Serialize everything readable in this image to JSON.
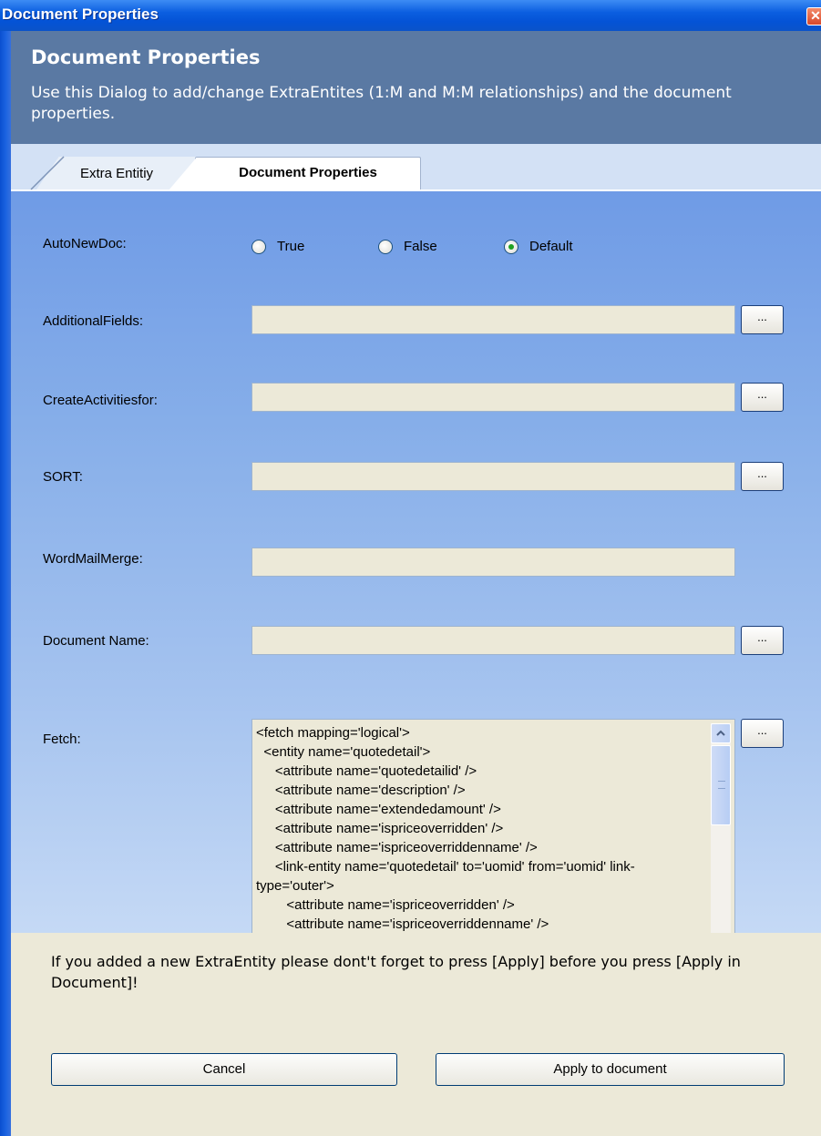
{
  "window": {
    "title": "Document Properties",
    "close_glyph": "✕"
  },
  "header": {
    "title": "Document Properties",
    "description": "Use this Dialog to add/change ExtraEntites (1:M and M:M relationships) and the document properties."
  },
  "tabs": [
    {
      "label": "Extra Entitiy",
      "active": false
    },
    {
      "label": "Document Properties",
      "active": true
    }
  ],
  "form": {
    "autonewdoc": {
      "label": "AutoNewDoc:",
      "options": [
        {
          "label": "True",
          "checked": false
        },
        {
          "label": "False",
          "checked": false
        },
        {
          "label": "Default",
          "checked": true
        }
      ]
    },
    "additional_fields": {
      "label": "AdditionalFields:",
      "value": "",
      "browse_label": "..."
    },
    "create_activities_for": {
      "label": "CreateActivitiesfor:",
      "value": "",
      "browse_label": "..."
    },
    "sort": {
      "label": "SORT:",
      "value": "",
      "browse_label": "..."
    },
    "word_mail_merge": {
      "label": "WordMailMerge:",
      "value": ""
    },
    "document_name": {
      "label": "Document Name:",
      "value": "",
      "browse_label": "..."
    },
    "fetch": {
      "label": "Fetch:",
      "browse_label": "...",
      "value": "<fetch mapping='logical'>\n  <entity name='quotedetail'>\n     <attribute name='quotedetailid' />\n     <attribute name='description' />\n     <attribute name='extendedamount' />\n     <attribute name='ispriceoverridden' />\n     <attribute name='ispriceoverriddenname' />\n     <link-entity name='quotedetail' to='uomid' from='uomid' link-type='outer'>\n        <attribute name='ispriceoverridden' />\n        <attribute name='ispriceoverriddenname' />"
    }
  },
  "footer": {
    "note": "If you added a new ExtraEntity please dont't forget to press [Apply] before you press [Apply in Document]!",
    "cancel_label": "Cancel",
    "apply_label": "Apply to document"
  },
  "icons": {
    "scroll_up": "up-arrow-icon",
    "scroll_down": "down-arrow-icon",
    "close": "close-icon"
  }
}
